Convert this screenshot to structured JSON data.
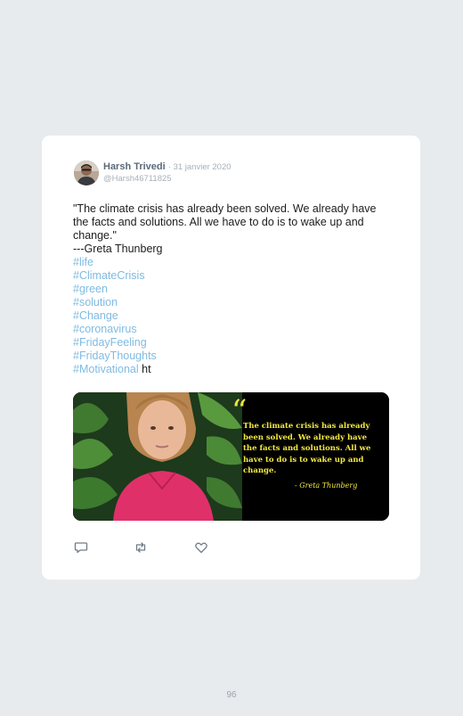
{
  "tweet": {
    "author_name": "Harsh Trivedi",
    "date": "· 31 janvier 2020",
    "handle": "@Harsh46711825",
    "text": "\"The climate crisis has already been solved. We already have the facts and solutions. All we have to do is to wake up and change.\"",
    "attribution": "---Greta Thunberg",
    "hashtags": [
      "#life",
      "#ClimateCrisis",
      "#green",
      "#solution",
      "#Change",
      "#coronavirus",
      "#FridayFeeling",
      "#FridayThoughts"
    ],
    "last_hashtag": "#Motivational",
    "trailing_text": " ht"
  },
  "media": {
    "quote_mark": "“",
    "quote": "The climate crisis has already been solved. We already have the facts and solutions. All we have to do is to wake up and change.",
    "quote_author": "- Greta Thunberg"
  },
  "actions": {
    "reply_icon": "reply-icon",
    "retweet_icon": "retweet-icon",
    "like_icon": "heart-icon"
  },
  "colors": {
    "background": "#e7ebee",
    "hashtag": "#7fbbe3",
    "quote_yellow": "#f4ea41"
  },
  "page_number": "96"
}
